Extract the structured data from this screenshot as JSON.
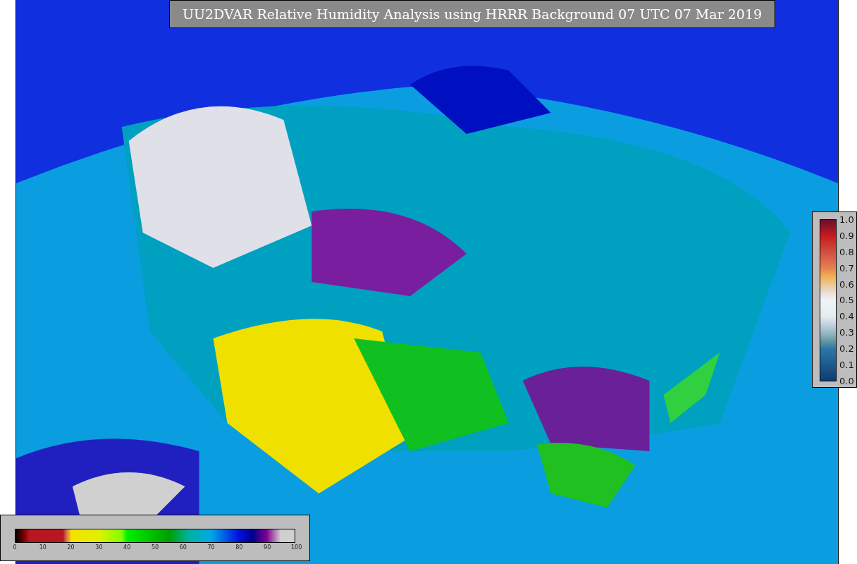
{
  "title": "UU2DVAR Relative Humidity Analysis using HRRR Background 07 UTC 07 Mar 2019",
  "humidity_colorbar": {
    "ticks": [
      "0",
      "10",
      "20",
      "30",
      "40",
      "50",
      "60",
      "70",
      "80",
      "90",
      "100"
    ]
  },
  "ratio_colorbar": {
    "ticks": [
      "1.0",
      "0.9",
      "0.8",
      "0.7",
      "0.6",
      "0.5",
      "0.4",
      "0.3",
      "0.2",
      "0.1",
      "0.0"
    ]
  }
}
